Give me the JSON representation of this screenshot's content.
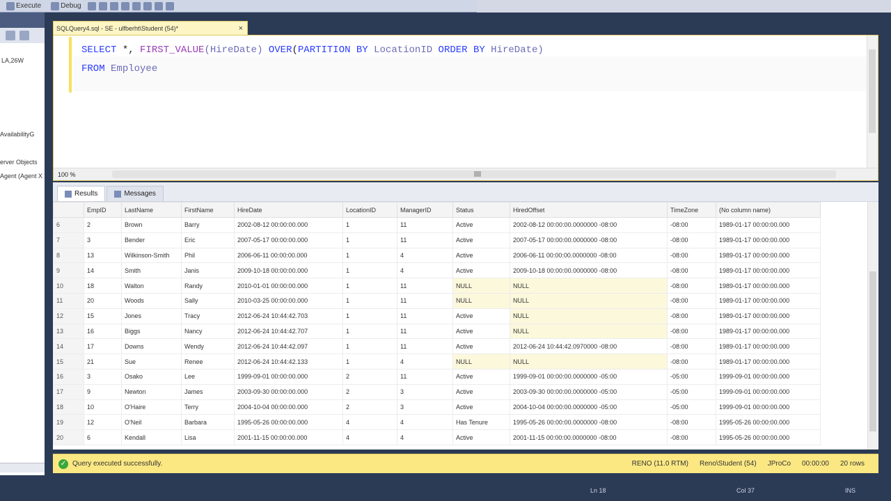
{
  "toolbar": {
    "execute_label": "Execute",
    "debug_label": "Debug"
  },
  "left_panel": {
    "server_label": "LA,26W",
    "tree_items": [
      "AvailabilityG",
      "erver Objects",
      "Agent (Agent X"
    ]
  },
  "doc_tab": {
    "title": "SQLQuery4.sql - SE - ulfberht\\Student (54)*",
    "close": "×"
  },
  "editor": {
    "line1_kw1": "SELECT",
    "line1_rest1": " *, ",
    "line1_fn": "FIRST_VALUE",
    "line1_rest2": "(HireDate) ",
    "line1_kw2": "OVER",
    "line1_rest3": "(",
    "line1_kw3": "PARTITION BY",
    "line1_rest4": " LocationID ",
    "line1_kw4": "ORDER BY",
    "line1_rest5": " HireDate)",
    "line2_kw": "FROM",
    "line2_rest": " Employee",
    "zoom": "100 %"
  },
  "result_tabs": {
    "results": "Results",
    "messages": "Messages"
  },
  "grid": {
    "columns": [
      "",
      "EmpID",
      "LastName",
      "FirstName",
      "HireDate",
      "LocationID",
      "ManagerID",
      "Status",
      "HiredOffset",
      "TimeZone",
      "(No column name)"
    ],
    "rows": [
      [
        "6",
        "2",
        "Brown",
        "Barry",
        "2002-08-12 00:00:00.000",
        "1",
        "11",
        "Active",
        "2002-08-12 00:00:00.0000000 -08:00",
        "-08:00",
        "1989-01-17 00:00:00.000"
      ],
      [
        "7",
        "3",
        "Bender",
        "Eric",
        "2007-05-17 00:00:00.000",
        "1",
        "11",
        "Active",
        "2007-05-17 00:00:00.0000000 -08:00",
        "-08:00",
        "1989-01-17 00:00:00.000"
      ],
      [
        "8",
        "13",
        "Wilkinson-Smith",
        "Phil",
        "2006-06-11 00:00:00.000",
        "1",
        "4",
        "Active",
        "2006-06-11 00:00:00.0000000 -08:00",
        "-08:00",
        "1989-01-17 00:00:00.000"
      ],
      [
        "9",
        "14",
        "Smith",
        "Janis",
        "2009-10-18 00:00:00.000",
        "1",
        "4",
        "Active",
        "2009-10-18 00:00:00.0000000 -08:00",
        "-08:00",
        "1989-01-17 00:00:00.000"
      ],
      [
        "10",
        "18",
        "Walton",
        "Randy",
        "2010-01-01 00:00:00.000",
        "1",
        "11",
        "NULL",
        "NULL",
        "-08:00",
        "1989-01-17 00:00:00.000"
      ],
      [
        "11",
        "20",
        "Woods",
        "Sally",
        "2010-03-25 00:00:00.000",
        "1",
        "11",
        "NULL",
        "NULL",
        "-08:00",
        "1989-01-17 00:00:00.000"
      ],
      [
        "12",
        "15",
        "Jones",
        "Tracy",
        "2012-06-24 10:44:42.703",
        "1",
        "11",
        "Active",
        "NULL",
        "-08:00",
        "1989-01-17 00:00:00.000"
      ],
      [
        "13",
        "16",
        "Biggs",
        "Nancy",
        "2012-06-24 10:44:42.707",
        "1",
        "11",
        "Active",
        "NULL",
        "-08:00",
        "1989-01-17 00:00:00.000"
      ],
      [
        "14",
        "17",
        "Downs",
        "Wendy",
        "2012-06-24 10:44:42.097",
        "1",
        "11",
        "Active",
        "2012-06-24 10:44:42.0970000 -08:00",
        "-08:00",
        "1989-01-17 00:00:00.000"
      ],
      [
        "15",
        "21",
        "Sue",
        "Renee",
        "2012-06-24 10:44:42.133",
        "1",
        "4",
        "NULL",
        "NULL",
        "-08:00",
        "1989-01-17 00:00:00.000"
      ],
      [
        "16",
        "3",
        "Osako",
        "Lee",
        "1999-09-01 00:00:00.000",
        "2",
        "11",
        "Active",
        "1999-09-01 00:00:00.0000000 -05:00",
        "-05:00",
        "1999-09-01 00:00:00.000"
      ],
      [
        "17",
        "9",
        "Newton",
        "James",
        "2003-09-30 00:00:00.000",
        "2",
        "3",
        "Active",
        "2003-09-30 00:00:00.0000000 -05:00",
        "-05:00",
        "1999-09-01 00:00:00.000"
      ],
      [
        "18",
        "10",
        "O'Haire",
        "Terry",
        "2004-10-04 00:00:00.000",
        "2",
        "3",
        "Active",
        "2004-10-04 00:00:00.0000000 -05:00",
        "-05:00",
        "1999-09-01 00:00:00.000"
      ],
      [
        "19",
        "12",
        "O'Neil",
        "Barbara",
        "1995-05-26 00:00:00.000",
        "4",
        "4",
        "Has Tenure",
        "1995-05-26 00:00:00.0000000 -08:00",
        "-08:00",
        "1995-05-26 00:00:00.000"
      ],
      [
        "20",
        "6",
        "Kendall",
        "Lisa",
        "2001-11-15 00:00:00.000",
        "4",
        "4",
        "Active",
        "2001-11-15 00:00:00.0000000 -08:00",
        "-08:00",
        "1995-05-26 00:00:00.000"
      ]
    ]
  },
  "status": {
    "message": "Query executed successfully.",
    "server": "RENO (11.0 RTM)",
    "user": "Reno\\Student (54)",
    "db": "JProCo",
    "time": "00:00:00",
    "rows": "20 rows"
  },
  "bottom": {
    "ln": "Ln 18",
    "col": "Col 37",
    "ins": "INS"
  }
}
